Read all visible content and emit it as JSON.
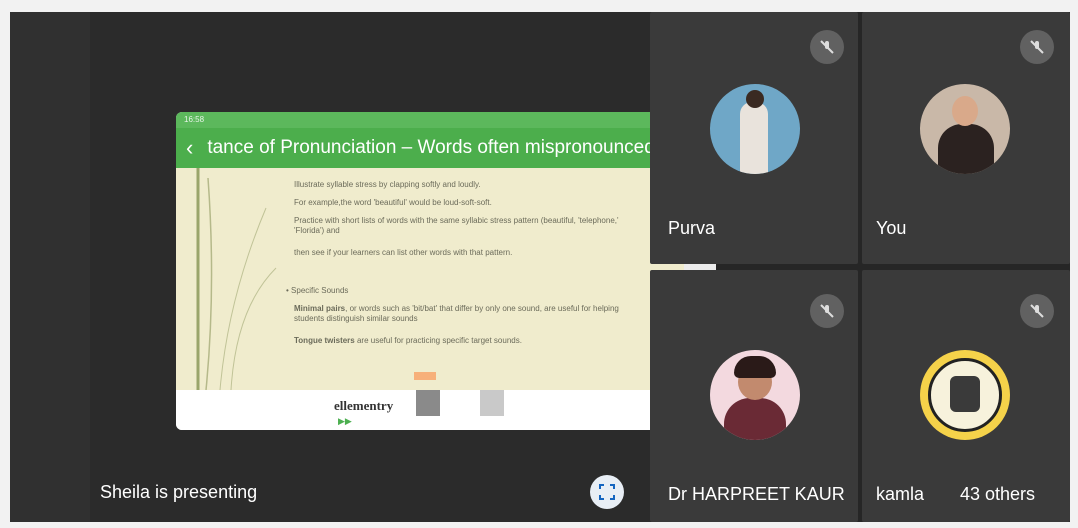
{
  "presentation": {
    "status_time": "16:58",
    "file_title": "tance of Pronunciation – Words often mispronounced.pptx",
    "slide": {
      "bullets": [
        "Illustrate syllable stress by clapping softly and loudly.",
        "For example,the word 'beautiful' would be loud-soft-soft.",
        "Practice with short lists of words with the same syllabic stress pattern (beautiful, 'telephone,' 'Florida') and",
        "then see if your learners can list other words with that pattern."
      ],
      "section_heading": "Specific Sounds",
      "paragraphs": [
        {
          "bold": "Minimal pairs",
          "rest": ", or words such as 'bit/bat' that differ by only one sound, are useful for helping students distinguish similar sounds"
        },
        {
          "bold": "Tongue twisters",
          "rest": " are useful for practicing specific target sounds."
        }
      ]
    },
    "footer": {
      "brand": "ellementry"
    }
  },
  "presenter_label": "Sheila is presenting",
  "participants": [
    {
      "name": "Purva"
    },
    {
      "name": "You"
    },
    {
      "name": "Dr HARPREET KAUR"
    },
    {
      "name": "kamla",
      "extra": "43 others"
    }
  ],
  "colors": {
    "tile_bg": "#3a3a3a",
    "accent_green": "#4cae4c",
    "mic_bg": "#616161"
  }
}
